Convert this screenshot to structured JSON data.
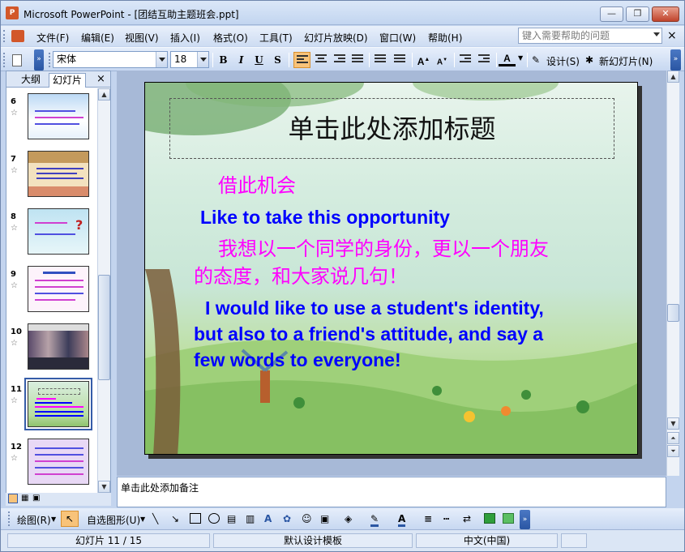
{
  "window": {
    "app_icon": "powerpoint-icon",
    "title": "Microsoft PowerPoint - [团结互助主题班会.ppt]",
    "buttons": {
      "minimize": "—",
      "restore": "❐",
      "close": "✕"
    }
  },
  "menubar": {
    "items": [
      "文件(F)",
      "编辑(E)",
      "视图(V)",
      "插入(I)",
      "格式(O)",
      "工具(T)",
      "幻灯片放映(D)",
      "窗口(W)",
      "帮助(H)"
    ],
    "help_placeholder": "键入需要帮助的问题",
    "close": "×"
  },
  "toolbar": {
    "font_name": "宋体",
    "font_size": "18",
    "bold": "B",
    "italic": "I",
    "underline": "U",
    "shadow": "S",
    "design_label": "设计(S)",
    "new_slide_label": "新幻灯片(N)",
    "font_color": "A"
  },
  "left_panel": {
    "tabs": [
      "大纲",
      "幻灯片"
    ],
    "close": "×",
    "slides": [
      {
        "num": "6"
      },
      {
        "num": "7"
      },
      {
        "num": "8"
      },
      {
        "num": "9"
      },
      {
        "num": "10"
      },
      {
        "num": "11"
      },
      {
        "num": "12"
      }
    ],
    "selected": "11"
  },
  "slide": {
    "title_placeholder": "单击此处添加标题",
    "cn1": "借此机会",
    "en1": "Like to take this opportunity",
    "cn2_line1": "我想以一个同学的身份，更以一个朋友",
    "cn2_line2": "的态度，和大家说几句！",
    "en2_line1": "I would like to use a student's identity,",
    "en2_line2": "but also to a friend's attitude, and say a",
    "en2_line3": "few words to  everyone!"
  },
  "notes": {
    "placeholder": "单击此处添加备注"
  },
  "drawbar": {
    "draw_label": "绘图(R)",
    "autoshape_label": "自选图形(U)"
  },
  "status": {
    "slide_pos": "幻灯片 11 / 15",
    "template": "默认设计模板",
    "language": "中文(中国)"
  }
}
